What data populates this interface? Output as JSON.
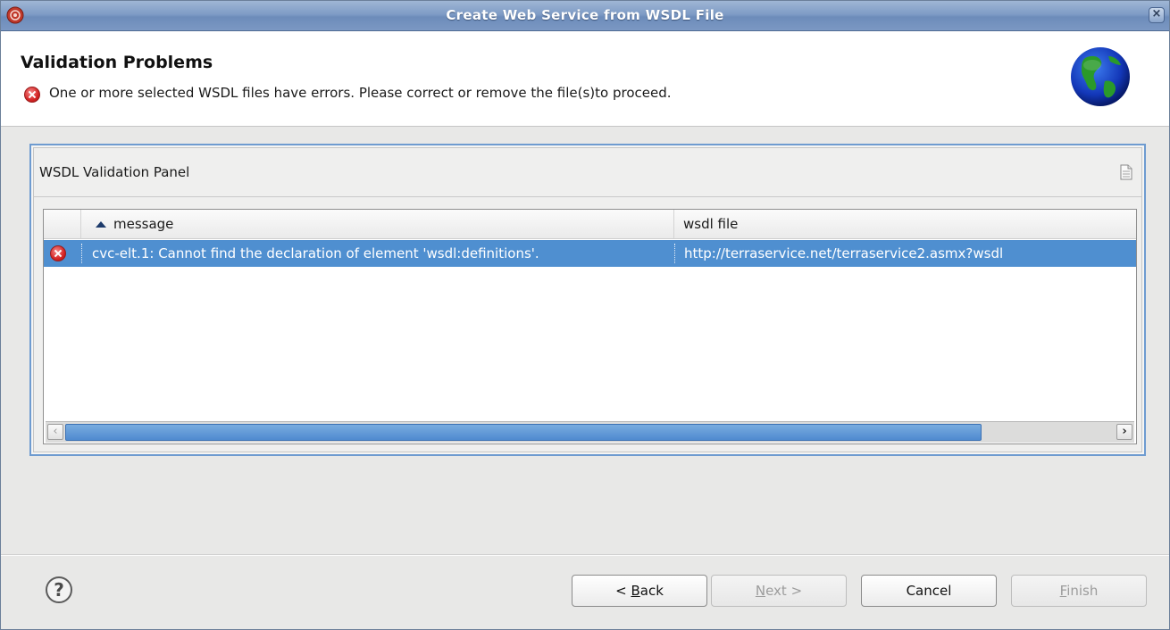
{
  "window": {
    "title": "Create Web Service from WSDL File",
    "close_glyph": "×"
  },
  "header": {
    "title": "Validation Problems",
    "message": "One or more selected WSDL files have errors. Please correct or remove the file(s)to proceed."
  },
  "panel": {
    "title": "WSDL Validation Panel",
    "table": {
      "columns": [
        {
          "label": "message",
          "sorted": "ascending"
        },
        {
          "label": "wsdl file"
        }
      ],
      "rows": [
        {
          "severity": "error",
          "message": "cvc-elt.1: Cannot find the declaration of element 'wsdl:definitions'.",
          "wsdl_file": "http://terraservice.net/terraservice2.asmx?wsdl",
          "selected": true
        }
      ]
    },
    "scroll_left_glyph": "‹",
    "scroll_right_glyph": "›"
  },
  "buttons": {
    "help_glyph": "?",
    "back_prefix": "< ",
    "back_mnemonic": "B",
    "back_rest": "ack",
    "next_mnemonic": "N",
    "next_rest": "ext >",
    "cancel": "Cancel",
    "finish_mnemonic": "F",
    "finish_rest": "inish"
  },
  "icons": [
    "app-icon",
    "close-icon",
    "error-icon",
    "globe-icon",
    "document-icon",
    "help-icon",
    "sort-ascending-icon"
  ],
  "colors": {
    "title_bar": "#7f9cc6",
    "selection": "#4f8fd0",
    "panel_border": "#6e9bd0"
  }
}
